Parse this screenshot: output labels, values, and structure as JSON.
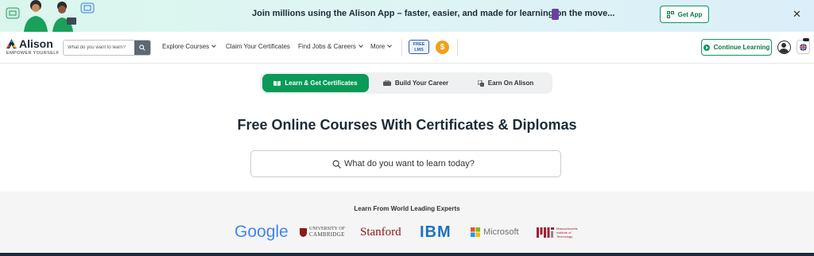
{
  "banner": {
    "text": "Join millions using the Alison App – faster, easier, and made for learning on the move...",
    "get_app_label": "Get App",
    "close_label": "✕"
  },
  "nav": {
    "logo_name": "Alison",
    "logo_tagline": "EMPOWER YOURSELF",
    "search_placeholder": "What do you want to learn?",
    "links": [
      {
        "label": "Explore Courses"
      },
      {
        "label": "Claim Your Certificates"
      },
      {
        "label": "Find Jobs & Careers"
      },
      {
        "label": "More"
      }
    ],
    "free_lms_line1": "FREE",
    "free_lms_line2": "LMS",
    "coin_symbol": "$",
    "continue_label": "Continue Learning"
  },
  "tabs": [
    {
      "label": "Learn & Get Certificates",
      "active": true
    },
    {
      "label": "Build Your Career",
      "active": false
    },
    {
      "label": "Earn On Alison",
      "active": false
    }
  ],
  "hero": {
    "title": "Free Online Courses With Certificates & Diplomas",
    "search_placeholder": "What do you want to learn today?"
  },
  "partners": {
    "title": "Learn From World Leading Experts",
    "logos": [
      {
        "name": "Google"
      },
      {
        "name": "UNIVERSITY OF CAMBRIDGE",
        "line1": "UNIVERSITY OF",
        "line2": "CAMBRIDGE"
      },
      {
        "name": "Stanford"
      },
      {
        "name": "IBM"
      },
      {
        "name": "Microsoft"
      },
      {
        "name": "MIT",
        "caption1": "Massachusetts",
        "caption2": "Institute of",
        "caption3": "Technology"
      }
    ]
  },
  "colors": {
    "brand_green": "#0a9a57",
    "dark_text": "#1d2b36",
    "coin_orange": "#f3a017"
  }
}
